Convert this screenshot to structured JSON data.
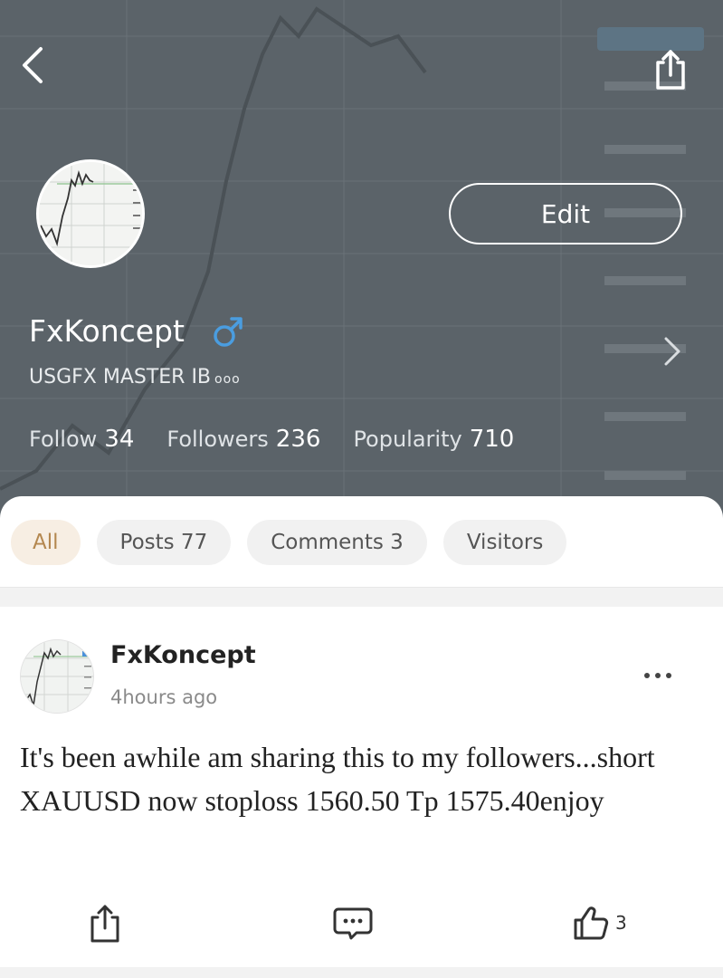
{
  "header": {
    "background_color": "#5b6369",
    "back_icon": "chevron-left-icon",
    "share_icon": "share-icon",
    "edit_label": "Edit"
  },
  "profile": {
    "name": "FxKoncept",
    "gender_icon": "male-icon",
    "bio": "USGFX MASTER IB",
    "bio_more": "ooo",
    "stats": [
      {
        "label": "Follow",
        "value": "34"
      },
      {
        "label": "Followers",
        "value": "236"
      },
      {
        "label": "Popularity",
        "value": "710"
      }
    ]
  },
  "tabs": [
    {
      "label": "All",
      "active": true
    },
    {
      "label": "Posts 77",
      "active": false
    },
    {
      "label": "Comments 3",
      "active": false
    },
    {
      "label": "Visitors",
      "active": false
    }
  ],
  "post": {
    "author": "FxKoncept",
    "time": "4hours ago",
    "text": "It's been awhile am sharing this to my followers...short XAUUSD now stoploss 1560.50 Tp 1575.40enjoy",
    "like_count": "3"
  },
  "colors": {
    "accent_tab_bg": "#f7eee3",
    "accent_tab_text": "#b4874f",
    "male_icon": "#4a9de0"
  }
}
